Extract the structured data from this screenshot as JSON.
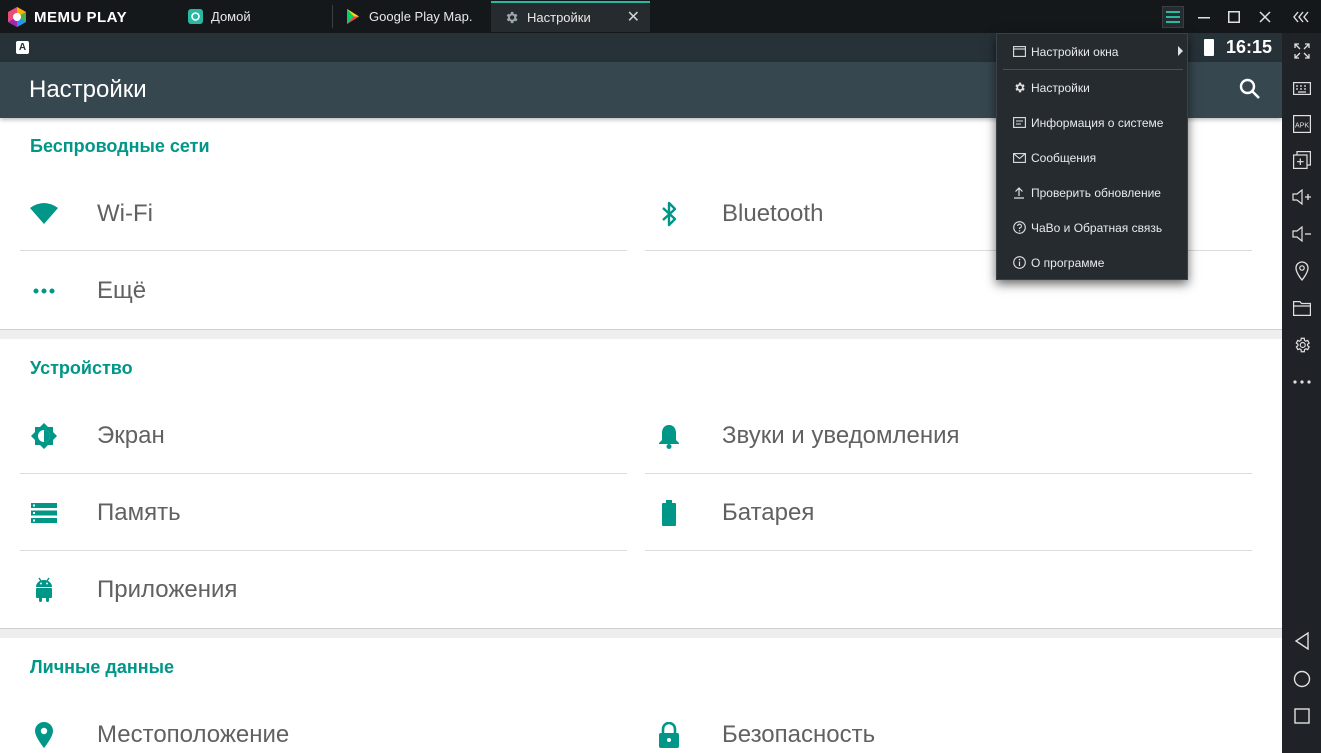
{
  "app": {
    "logo_text": "MEMU PLAY"
  },
  "tabs": [
    {
      "label": "Домой",
      "icon": "memu-home-icon"
    },
    {
      "label": "Google Play Мар.",
      "icon": "play-store-icon"
    },
    {
      "label": "Настройки",
      "icon": "settings-gear-icon",
      "active": true
    }
  ],
  "window_controls": [
    "menu-icon",
    "minimize-icon",
    "maximize-icon",
    "close-icon",
    "collapse-sidebar-icon"
  ],
  "android": {
    "status_bar": {
      "clock": "16:15",
      "keyboard_badge": "A"
    },
    "app_bar": {
      "title": "Настройки"
    },
    "sections": [
      {
        "title": "Беспроводные сети",
        "items": [
          {
            "label": "Wi-Fi",
            "icon": "wifi-icon"
          },
          {
            "label": "Bluetooth",
            "icon": "bluetooth-icon"
          },
          {
            "label": "Ещё",
            "icon": "more-dots-icon"
          }
        ]
      },
      {
        "title": "Устройство",
        "items": [
          {
            "label": "Экран",
            "icon": "brightness-icon"
          },
          {
            "label": "Звуки и уведомления",
            "icon": "bell-icon"
          },
          {
            "label": "Память",
            "icon": "storage-icon"
          },
          {
            "label": "Батарея",
            "icon": "battery-icon"
          },
          {
            "label": "Приложения",
            "icon": "android-icon"
          }
        ]
      },
      {
        "title": "Личные данные",
        "items": [
          {
            "label": "Местоположение",
            "icon": "location-pin-icon"
          },
          {
            "label": "Безопасность",
            "icon": "lock-icon"
          }
        ]
      }
    ]
  },
  "dropdown_menu": {
    "items": [
      {
        "label": "Настройки окна",
        "icon": "window-icon",
        "has_submenu": true
      },
      {
        "label": "Настройки",
        "icon": "gear-icon"
      },
      {
        "label": "Информация о системе",
        "icon": "info-card-icon"
      },
      {
        "label": "Сообщения",
        "icon": "mail-icon"
      },
      {
        "label": "Проверить обновление",
        "icon": "upload-icon"
      },
      {
        "label": "ЧаВо и Обратная связь",
        "icon": "help-icon"
      },
      {
        "label": "О программе",
        "icon": "about-icon"
      }
    ]
  },
  "sidebar": {
    "buttons": [
      "fullscreen-icon",
      "keyboard-icon",
      "apk-icon",
      "multi-window-icon",
      "volume-up-icon",
      "volume-down-icon",
      "location-icon",
      "folder-icon",
      "settings-icon",
      "more-icon",
      "back-icon",
      "home-icon",
      "recents-icon"
    ],
    "apk_label": "APK"
  },
  "colors": {
    "accent": "#009688",
    "titlebar": "#15181b",
    "appbar": "#37474f",
    "statusbar": "#263238",
    "memu_accent": "#2ab8a3"
  }
}
